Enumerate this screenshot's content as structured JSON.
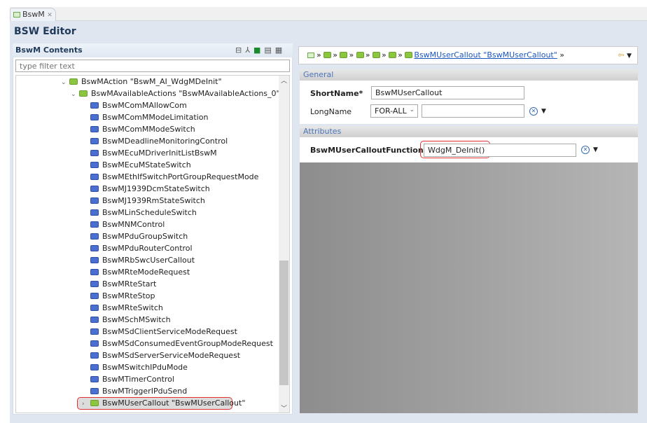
{
  "tab": {
    "label": "BswM"
  },
  "editor": {
    "title": "BSW Editor"
  },
  "contents": {
    "title": "BswM Contents",
    "filter_placeholder": "type filter text",
    "tree": [
      {
        "label": "BswMAction \"BswM_AI_WdgMDeInit\"",
        "level": 0,
        "icon": "green",
        "expanded": true
      },
      {
        "label": "BswMAvailableActions \"BswMAvailableActions_0\"",
        "level": 1,
        "icon": "green",
        "expanded": true
      },
      {
        "label": "BswMComMAllowCom",
        "level": 2,
        "icon": "blue"
      },
      {
        "label": "BswMComMModeLimitation",
        "level": 2,
        "icon": "blue"
      },
      {
        "label": "BswMComMModeSwitch",
        "level": 2,
        "icon": "blue"
      },
      {
        "label": "BswMDeadlineMonitoringControl",
        "level": 2,
        "icon": "blue"
      },
      {
        "label": "BswMEcuMDriverInitListBswM",
        "level": 2,
        "icon": "blue"
      },
      {
        "label": "BswMEcuMStateSwitch",
        "level": 2,
        "icon": "blue"
      },
      {
        "label": "BswMEthIfSwitchPortGroupRequestMode",
        "level": 2,
        "icon": "blue"
      },
      {
        "label": "BswMJ1939DcmStateSwitch",
        "level": 2,
        "icon": "blue"
      },
      {
        "label": "BswMJ1939RmStateSwitch",
        "level": 2,
        "icon": "blue"
      },
      {
        "label": "BswMLinScheduleSwitch",
        "level": 2,
        "icon": "blue"
      },
      {
        "label": "BswMNMControl",
        "level": 2,
        "icon": "blue"
      },
      {
        "label": "BswMPduGroupSwitch",
        "level": 2,
        "icon": "blue"
      },
      {
        "label": "BswMPduRouterControl",
        "level": 2,
        "icon": "blue"
      },
      {
        "label": "BswMRbSwcUserCallout",
        "level": 2,
        "icon": "blue"
      },
      {
        "label": "BswMRteModeRequest",
        "level": 2,
        "icon": "blue"
      },
      {
        "label": "BswMRteStart",
        "level": 2,
        "icon": "blue"
      },
      {
        "label": "BswMRteStop",
        "level": 2,
        "icon": "blue"
      },
      {
        "label": "BswMRteSwitch",
        "level": 2,
        "icon": "blue"
      },
      {
        "label": "BswMSchMSwitch",
        "level": 2,
        "icon": "blue"
      },
      {
        "label": "BswMSdClientServiceModeRequest",
        "level": 2,
        "icon": "blue"
      },
      {
        "label": "BswMSdConsumedEventGroupModeRequest",
        "level": 2,
        "icon": "blue"
      },
      {
        "label": "BswMSdServerServiceModeRequest",
        "level": 2,
        "icon": "blue"
      },
      {
        "label": "BswMSwitchIPduMode",
        "level": 2,
        "icon": "blue"
      },
      {
        "label": "BswMTimerControl",
        "level": 2,
        "icon": "blue"
      },
      {
        "label": "BswMTriggerIPduSend",
        "level": 2,
        "icon": "blue"
      },
      {
        "label": "BswMUserCallout \"BswMUserCallout\"",
        "level": 2,
        "icon": "green",
        "collapsed": true,
        "selected": true
      }
    ]
  },
  "breadcrumb": {
    "current": "BswMUserCallout \"BswMUserCallout\""
  },
  "general": {
    "title": "General",
    "shortname_label": "ShortName*",
    "shortname_value": "BswMUserCallout",
    "longname_label": "LongName",
    "language": "FOR-ALL",
    "longname_value": ""
  },
  "attributes": {
    "title": "Attributes",
    "function_label": "BswMUserCalloutFunction*",
    "function_value": "WdgM_DeInit()"
  },
  "colors": {
    "highlight": "#e03030",
    "link": "#1a55c0",
    "section_title": "#4a74b8"
  }
}
